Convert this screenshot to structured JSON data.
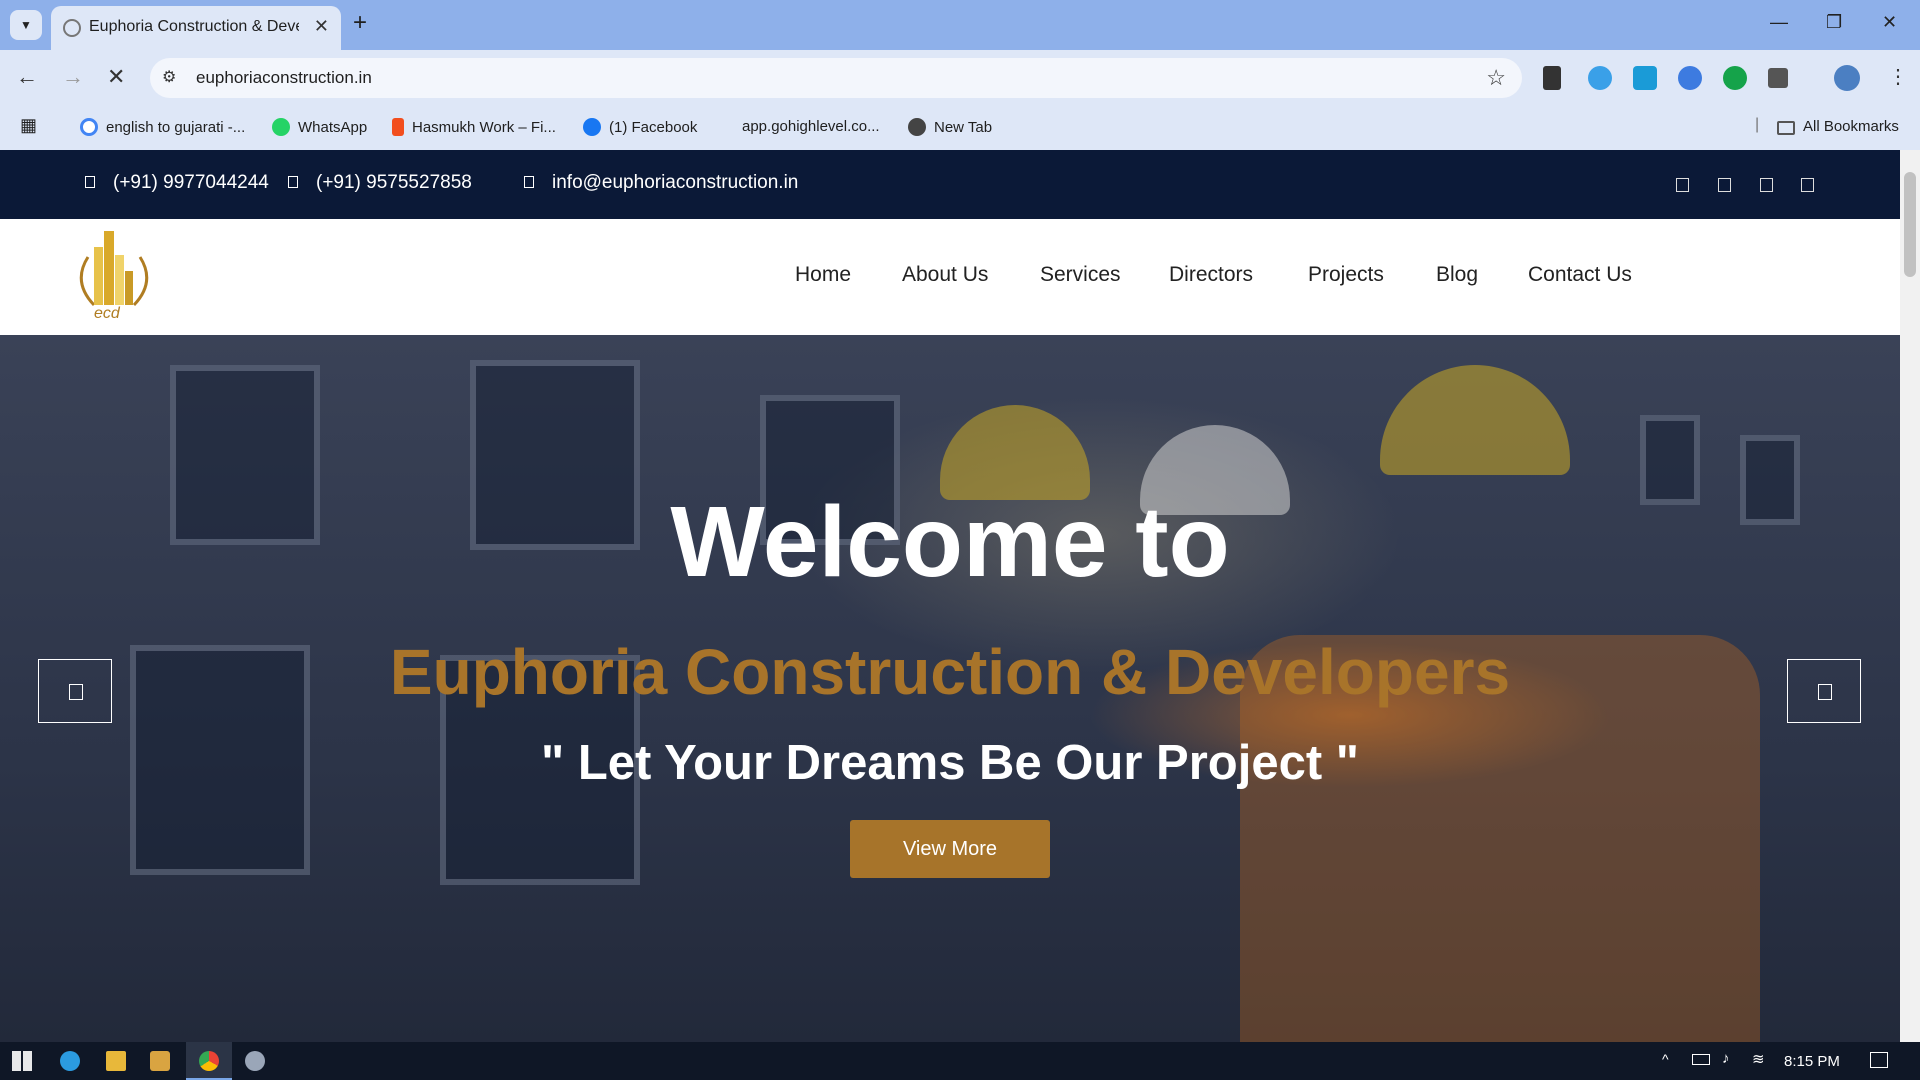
{
  "browser": {
    "tab_title": "Euphoria Construction & Devel",
    "url": "euphoriaconstruction.in",
    "bookmarks": [
      {
        "label": "english to gujarati -..."
      },
      {
        "label": "WhatsApp"
      },
      {
        "label": "Hasmukh Work – Fi..."
      },
      {
        "label": "(1) Facebook"
      },
      {
        "label": "app.gohighlevel.co..."
      },
      {
        "label": "New Tab"
      }
    ],
    "all_bookmarks": "All Bookmarks"
  },
  "site": {
    "phone1": "(+91) 9977044244",
    "phone2": "(+91) 9575527858",
    "email": "info@euphoriaconstruction.in",
    "logo_text": "ecd",
    "nav": [
      "Home",
      "About Us",
      "Services",
      "Directors",
      "Projects",
      "Blog",
      "Contact Us"
    ],
    "hero": {
      "title": "Welcome to",
      "company": "Euphoria Construction & Developers",
      "tagline": "\" Let Your Dreams Be Our Project \"",
      "button": "View More"
    }
  },
  "taskbar": {
    "time": "8:15 PM"
  },
  "colors": {
    "accent": "#a7742a",
    "topbar": "#0b1937",
    "chrome_frame": "#8eb0ea"
  }
}
